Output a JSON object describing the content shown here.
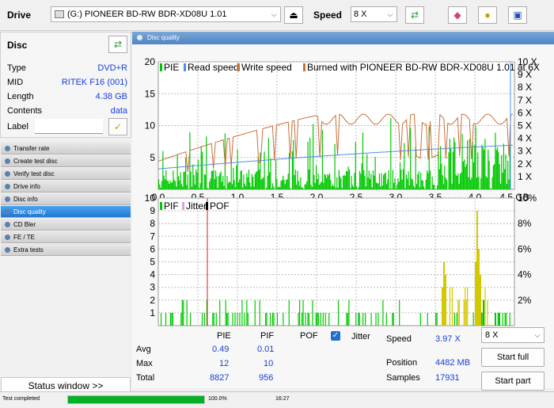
{
  "toolbar": {
    "drive_label": "Drive",
    "drive_value": "(G:)   PIONEER BD-RW   BDR-XD08U 1.01",
    "speed_label": "Speed",
    "speed_value": "8 X"
  },
  "disc": {
    "header": "Disc",
    "type_label": "Type",
    "type_value": "DVD+R",
    "mid_label": "MID",
    "mid_value": "RITEK F16 (001)",
    "length_label": "Length",
    "length_value": "4.38 GB",
    "contents_label": "Contents",
    "contents_value": "data",
    "label_label": "Label"
  },
  "nav": [
    {
      "label": "Transfer rate"
    },
    {
      "label": "Create test disc"
    },
    {
      "label": "Verify test disc"
    },
    {
      "label": "Drive info"
    },
    {
      "label": "Disc info"
    },
    {
      "label": "Disc quality"
    },
    {
      "label": "CD Bler"
    },
    {
      "label": "FE / TE"
    },
    {
      "label": "Extra tests"
    }
  ],
  "status_window_label": "Status window >>",
  "panel_title": "Disc quality",
  "chart_data": [
    {
      "type": "bar",
      "legend": [
        "PIE",
        "Read speed",
        "Write speed",
        "Burned with PIONEER BD-RW  BDR-XD08U 1.01 at 6X"
      ],
      "x_ticks": [
        "0.0",
        "0.5",
        "1.0",
        "1.5",
        "2.0",
        "2.5",
        "3.0",
        "3.5",
        "4.0",
        "4.5 GB"
      ],
      "y_ticks_left": [
        "20",
        "15",
        "10",
        "5"
      ],
      "y_ticks_right": [
        "10 X",
        "9 X",
        "8 X",
        "7 X",
        "6 X",
        "5 X",
        "4 X",
        "3 X",
        "2 X",
        "1 X"
      ],
      "xlim": [
        0,
        4.5
      ],
      "ylim": [
        0,
        20
      ],
      "colors": {
        "pie": "#00c800",
        "read": "#4a8ff0",
        "write": "#c8703a"
      }
    },
    {
      "type": "bar",
      "legend": [
        "PIF",
        "Jitter",
        "POF"
      ],
      "x_ticks": [
        "0.0",
        "0.5",
        "1.0",
        "1.5",
        "2.0",
        "2.5",
        "3.0",
        "3.5",
        "4.0",
        "4.5 GB"
      ],
      "y_ticks_left": [
        "10",
        "9",
        "8",
        "7",
        "6",
        "5",
        "4",
        "3",
        "2",
        "1"
      ],
      "y_ticks_right": [
        "10%",
        "8%",
        "6%",
        "4%",
        "2%"
      ],
      "xlim": [
        0,
        4.5
      ],
      "ylim": [
        0,
        10
      ],
      "colors": {
        "pif": "#00c800",
        "pif_high": "#d4c800",
        "marker": "#d02020"
      }
    }
  ],
  "stats": {
    "col_pie": "PIE",
    "col_pif": "PIF",
    "col_pof": "POF",
    "jitter_label": "Jitter",
    "avg_label": "Avg",
    "avg_pie": "0.49",
    "avg_pif": "0.01",
    "max_label": "Max",
    "max_pie": "12",
    "max_pif": "10",
    "total_label": "Total",
    "total_pie": "8827",
    "total_pif": "956",
    "speed_label": "Speed",
    "speed_value": "3.97 X",
    "position_label": "Position",
    "position_value": "4482 MB",
    "samples_label": "Samples",
    "samples_value": "17931",
    "speed_select": "8 X",
    "start_full": "Start full",
    "start_part": "Start part"
  },
  "status": {
    "text": "Test completed",
    "progress": 1.0,
    "percent": "100.0%",
    "time": "16:27"
  }
}
